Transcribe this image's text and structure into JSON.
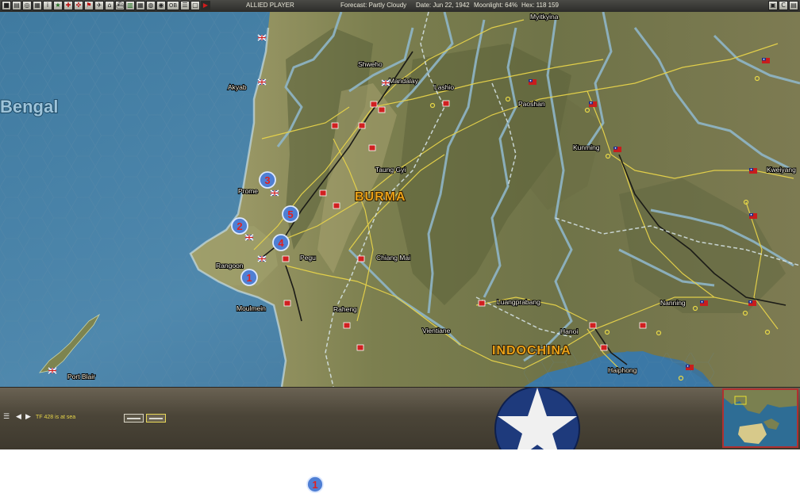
{
  "toolbar": {
    "buttons": [
      {
        "name": "mode-icon",
        "glyph": "■"
      },
      {
        "name": "report-icon",
        "glyph": "▤"
      },
      {
        "name": "intel-icon",
        "glyph": "◎"
      },
      {
        "name": "print-icon",
        "glyph": "▦"
      },
      {
        "name": "info-icon",
        "glyph": "i"
      },
      {
        "name": "star-icon",
        "glyph": "★"
      },
      {
        "name": "medical-icon",
        "glyph": "✚"
      },
      {
        "name": "target-icon",
        "glyph": "✜"
      },
      {
        "name": "flag-icon",
        "glyph": "⚑"
      },
      {
        "name": "aircraft-icon",
        "glyph": "✈"
      },
      {
        "name": "base-icon",
        "glyph": "⌂"
      },
      {
        "name": "ship-icon",
        "glyph": "⛴"
      },
      {
        "name": "chart-icon",
        "glyph": "▥"
      },
      {
        "name": "grid-icon",
        "glyph": "▦"
      },
      {
        "name": "globe-icon",
        "glyph": "◍"
      },
      {
        "name": "world-icon",
        "glyph": "◉"
      },
      {
        "name": "ob-icon",
        "glyph": "OB"
      },
      {
        "name": "list-icon",
        "glyph": "☰"
      },
      {
        "name": "window-icon",
        "glyph": "▢"
      },
      {
        "name": "end-turn-icon",
        "glyph": "▶"
      }
    ],
    "right_buttons": [
      {
        "name": "settings-icon",
        "glyph": "▣"
      },
      {
        "name": "center-icon",
        "glyph": "C"
      },
      {
        "name": "exit-icon",
        "glyph": "▤"
      }
    ]
  },
  "status": {
    "player": "ALLIED PLAYER",
    "forecast": "Forecast: Partly Cloudy",
    "date": "Date: Jun 22, 1942",
    "moonlight": "Moonlight: 64%",
    "hex": "Hex: 118 159"
  },
  "map": {
    "regions": [
      "BURMA",
      "INDOCHINA"
    ],
    "sea": "Bengal",
    "places": [
      "Myitkyina",
      "Shweho",
      "Lashio",
      "Mandalay",
      "Akyab",
      "Paoshan",
      "Kunming",
      "Kweiyang",
      "Taung Gyi",
      "Prome",
      "Pegu",
      "Rangoon",
      "Chiang Mai",
      "Moulmein",
      "Raheng",
      "Luangprabang",
      "Vientiane",
      "Nanning",
      "Hanoi",
      "Haiphong",
      "Port Blair"
    ],
    "markers": [
      "1",
      "2",
      "3",
      "4",
      "5"
    ]
  },
  "panel": {
    "tf_status": "TF 428 is at sea"
  },
  "annotation": {
    "marker": "1"
  }
}
